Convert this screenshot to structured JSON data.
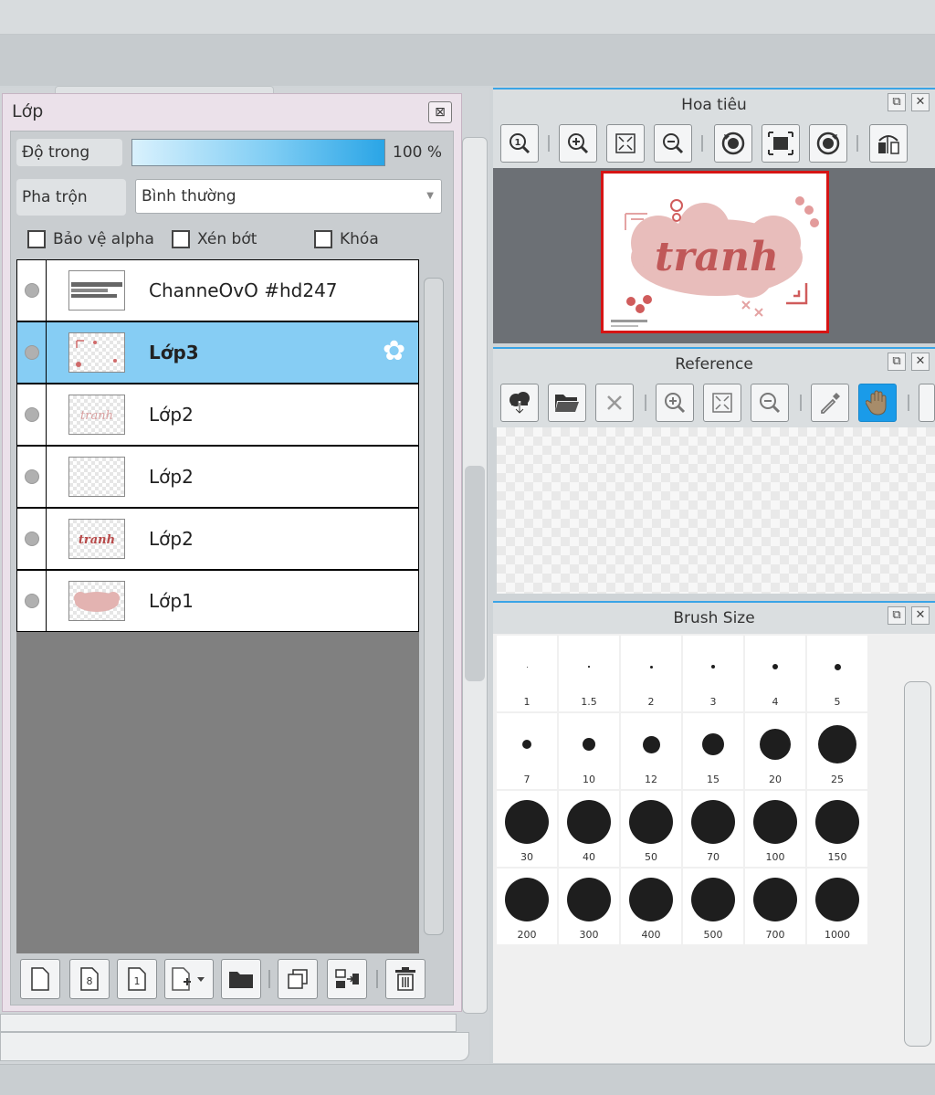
{
  "layers_panel": {
    "title": "Lớp",
    "close_icon": "close-icon",
    "opacity_label": "Độ trong",
    "opacity_value": "100 %",
    "opacity_fraction": 1.0,
    "blend_label": "Pha trộn",
    "blend_value": "Bình thường",
    "checkboxes": {
      "protect_alpha": "Bảo vệ alpha",
      "clipping": "Xén bớt",
      "lock": "Khóa"
    },
    "layers": [
      {
        "name": "ChanneOvO #hd247",
        "selected": false
      },
      {
        "name": "Lớp3",
        "selected": true
      },
      {
        "name": "Lớp2",
        "selected": false
      },
      {
        "name": "Lớp2",
        "selected": false
      },
      {
        "name": "Lớp2",
        "selected": false
      },
      {
        "name": "Lớp1",
        "selected": false
      }
    ],
    "toolbar_icons": [
      "new-layer-icon",
      "new-8bit-layer-icon",
      "new-1bit-layer-icon",
      "add-layer-dropdown-icon",
      "new-folder-icon",
      "duplicate-layer-icon",
      "merge-down-icon",
      "delete-layer-icon"
    ]
  },
  "navigator_panel": {
    "title": "Hoa tiêu",
    "thumbnail_text": "tranh",
    "tool_icons": [
      "zoom-reset-icon",
      "zoom-in-icon",
      "fit-icon",
      "zoom-out-icon",
      "rotate-left-icon",
      "fit-window-icon",
      "rotate-right-icon",
      "flip-icon"
    ]
  },
  "reference_panel": {
    "title": "Reference",
    "tool_icons": [
      "load-icon",
      "open-folder-icon",
      "close-icon",
      "zoom-in-icon",
      "fit-icon",
      "zoom-out-icon",
      "eyedropper-icon",
      "hand-icon"
    ]
  },
  "brush_size_panel": {
    "title": "Brush Size",
    "sizes": [
      "1",
      "1.5",
      "2",
      "3",
      "4",
      "5",
      "7",
      "10",
      "12",
      "15",
      "20",
      "25",
      "30",
      "40",
      "50",
      "70",
      "100",
      "150",
      "200",
      "300",
      "400",
      "500",
      "700",
      "1000"
    ]
  },
  "colors": {
    "accent": "#3aa4e6",
    "selected_layer": "#86cdf4",
    "active_tool": "#1a9be9",
    "nav_frame": "#d61414"
  }
}
